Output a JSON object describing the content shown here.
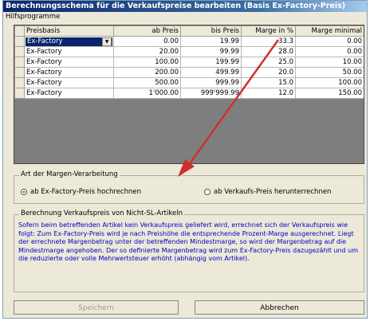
{
  "window": {
    "title": "Berechnungsschema für die Verkaufspreise bearbeiten (Basis Ex-Factory-Preis)"
  },
  "menu": {
    "label": "Hilfsprogramme"
  },
  "grid": {
    "headers": [
      "Preisbasis",
      "ab Preis",
      "bis Preis",
      "Marge in %",
      "Marge minimal"
    ],
    "rows": [
      [
        "Ex-Factory",
        "0.00",
        "19.99",
        "33.3",
        "0.00"
      ],
      [
        "Ex-Factory",
        "20.00",
        "99.99",
        "28.0",
        "0.00"
      ],
      [
        "Ex-Factory",
        "100.00",
        "199.99",
        "25.0",
        "10.00"
      ],
      [
        "Ex-Factory",
        "200.00",
        "499.99",
        "20.0",
        "50.00"
      ],
      [
        "Ex-Factory",
        "500.00",
        "999.99",
        "15.0",
        "100.00"
      ],
      [
        "Ex-Factory",
        "1'000.00",
        "999'999.99",
        "12.0",
        "150.00"
      ]
    ],
    "combo_arrow": "▼"
  },
  "margin_group": {
    "legend": "Art der Margen-Verarbeitung",
    "option1": "ab Ex-Factory-Preis hochrechnen",
    "option2": "ab Verkaufs-Preis herunterrechnen",
    "selected": 1
  },
  "info_group": {
    "legend": "Berechnung Verkaufspreis von Nicht-SL-Artikeln",
    "text": "Sofern beim betreffenden Artikel kein Verkaufspreis geliefert wird, errechnet sich der Verkaufspreis wie folgt: Zum Ex-Factory-Preis wird je nach Preishöhe die entsprechende Prozent-Marge ausgerechnet. Liegt der errechnete Margenbetrag unter der betreffenden Mindestmarge, so wird der Margenbetrag auf die Mindestmarge angehoben. Der so definierte Margenbetrag wird zum Ex-Factory-Preis dazugezählt und um die reduzierte oder volle Mehrwertsteuer erhöht (abhängig vom Artikel)."
  },
  "buttons": {
    "save": "Speichern",
    "cancel": "Abbrechen"
  },
  "colors": {
    "arrow": "#d03030",
    "title_bar": "#0a246a",
    "info_text": "#0000cc"
  }
}
